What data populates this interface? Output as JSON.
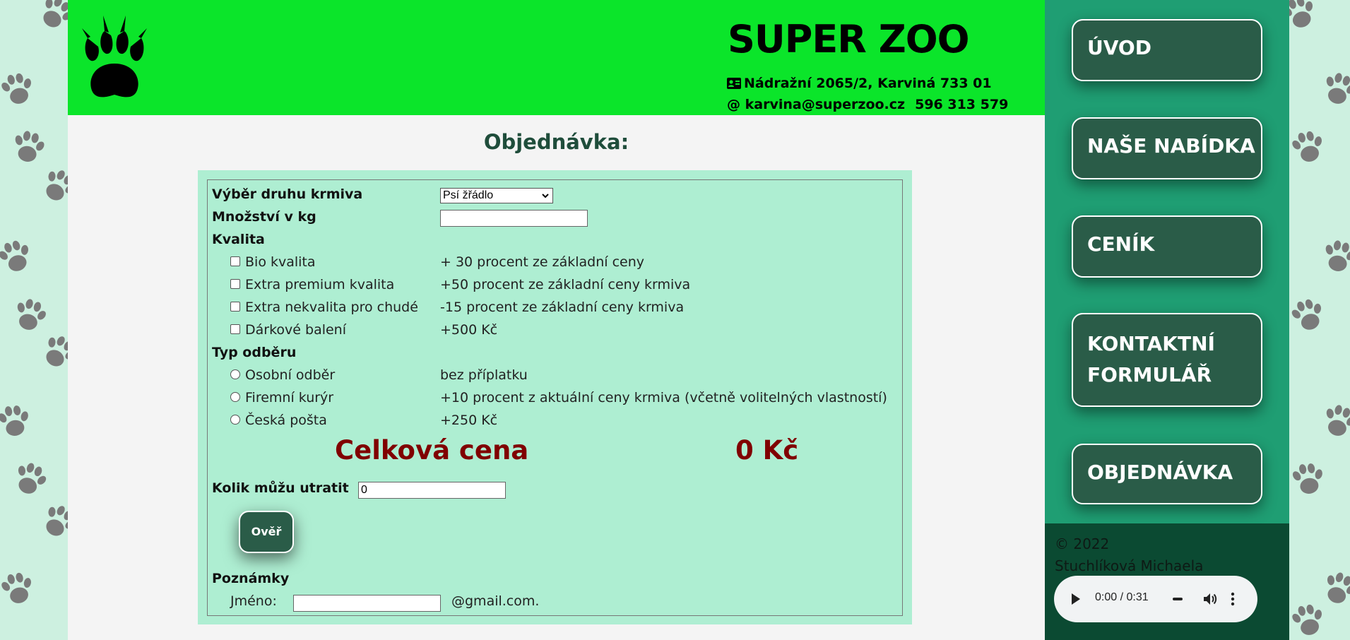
{
  "header": {
    "title": "SUPER ZOO",
    "address": "Nádražní 2065/2, Karviná 733 01",
    "email": "@ karvina@superzoo.cz",
    "phone": "596 313 579"
  },
  "order": {
    "heading": "Objednávka:",
    "food_type_label": "Výběr druhu krmiva",
    "food_type_selected": "Psí žřádlo",
    "amount_label": "Množství v kg",
    "amount_value": "",
    "quality_label": "Kvalita",
    "quality_options": [
      {
        "label": "Bio kvalita",
        "desc": "+ 30 procent ze základní ceny"
      },
      {
        "label": "Extra premium kvalita",
        "desc": "+50 procent ze základní ceny krmiva"
      },
      {
        "label": "Extra nekvalita pro chudé",
        "desc": "-15 procent ze základní ceny krmiva"
      },
      {
        "label": "Dárkové balení",
        "desc": "+500 Kč"
      }
    ],
    "delivery_label": "Typ odběru",
    "delivery_options": [
      {
        "label": "Osobní odběr",
        "desc": "bez příplatku"
      },
      {
        "label": "Firemní kurýr",
        "desc": "+10 procent z aktuální ceny krmiva (včetně volitelných vlastností)"
      },
      {
        "label": "Česká pošta",
        "desc": "+250 Kč"
      }
    ],
    "total_label": "Celková cena",
    "total_value": "0 Kč",
    "budget_label": "Kolik můžu utratit",
    "budget_value": "0",
    "verify_button": "Ověř",
    "notes_label": "Poznámky",
    "name_label": "Jméno:",
    "name_value": "",
    "email_suffix": "@gmail.com."
  },
  "nav": [
    {
      "line1": "ÚVOD",
      "line2": ""
    },
    {
      "line1": "NAŠE NABÍDKA",
      "line2": ""
    },
    {
      "line1": "CENÍK",
      "line2": ""
    },
    {
      "line1": "KONTAKTNÍ",
      "line2": "FORMULÁŘ"
    },
    {
      "line1": "OBJEDNÁVKA",
      "line2": ""
    }
  ],
  "footer": {
    "copyright": "©  2022",
    "author": "Stuchlíková Michaela",
    "audio_time": "0:00 / 0:31"
  },
  "colors": {
    "header_bg": "#0be52a",
    "sidebar_bg": "#1f9e73",
    "nav_button": "#2a5c48",
    "form_bg": "#aeeed2",
    "total_red": "#800000",
    "footer_bg": "#0b4a32"
  },
  "icons": [
    "paw-logo",
    "address-card-icon",
    "play-icon",
    "volume-icon",
    "more-icon",
    "chevron-down-icon"
  ]
}
